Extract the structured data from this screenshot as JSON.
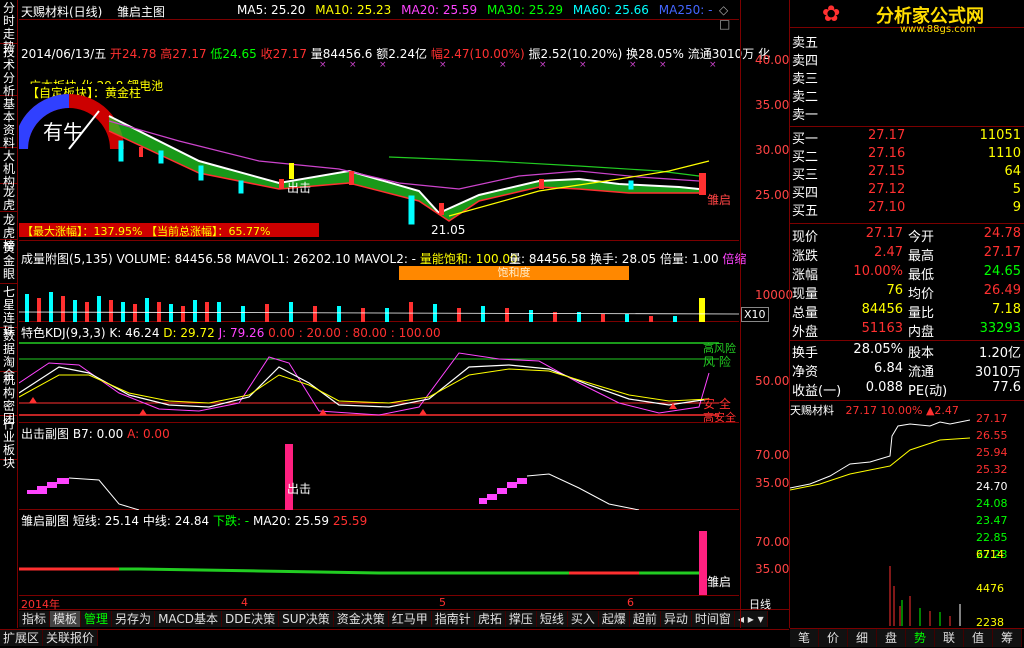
{
  "left_tabs": [
    "分时走势",
    "技术分析",
    "基本资料",
    "大机构",
    "龙虎",
    "龙虎榜",
    "黄金眼",
    "七星连珠",
    "数据淘金",
    "机构密团",
    "行业板块"
  ],
  "title": {
    "stock": "天赐材料(日线)",
    "formula": "雏启主图",
    "ma5": "MA5: 25.20",
    "ma10": "MA10: 25.23",
    "ma20": "MA20: 25.59",
    "ma30": "MA30: 25.29",
    "ma60": "MA60: 25.66",
    "ma250": "MA250: -"
  },
  "info_line": {
    "date": "2014/06/13/五",
    "open": "开24.78",
    "high": "高27.17",
    "low": "低24.65",
    "close": "收27.17",
    "vol": "量84456.6",
    "amt": "额2.24亿",
    "pct": "幅2.47(10.00%)",
    "amp": "振2.52(10.20%)",
    "turnover": "换28.05%",
    "float": "流通3010万",
    "extra": "化"
  },
  "main_panel": {
    "board_label": "【自定板块】：黄金柱",
    "overlay_text": "广本板块 化 29.8 锂电池",
    "gauge_label": "有牛",
    "signal_chuji": "出击",
    "signal_chuqi": "雏启",
    "low_label": "21.05",
    "max_gain": "【最大涨幅】：137.95%",
    "cur_gain": "【当前总涨幅】：65.77%",
    "yticks": [
      "40.00",
      "35.00",
      "30.00",
      "25.00"
    ]
  },
  "volume_panel": {
    "label": "成量附图(5,135)",
    "vol": "VOLUME: 84456.58",
    "mavol1": "MAVOL1: 26202.10",
    "mavol2": "MAVOL2: -",
    "sat": "量能饱和: 100.00",
    "right": "量: 84456.58",
    "turn": "换手: 28.05",
    "mult": "倍量: 1.00",
    "shrink": "倍缩",
    "badge": "饱和度",
    "ytick": "10000",
    "x10": "X10"
  },
  "kdj_panel": {
    "label": "特色KDJ(9,3,3)",
    "k": "K: 46.24",
    "d": "D: 29.72",
    "j": "J: 79.26",
    "levels": "0.00 : 20.00 : 80.00 : 100.00",
    "high_risk": "高风险",
    "risk": "风 险",
    "safe": "安 全",
    "high_safe": "高安全",
    "ytick": "50.00"
  },
  "chuji_panel": {
    "label": "出击副图",
    "b7": "B7: 0.00",
    "a": "A: 0.00",
    "signal": "出击",
    "yticks": [
      "70.00",
      "35.00"
    ]
  },
  "chuqi_panel": {
    "label": "雏启副图",
    "short": "短线: 25.14",
    "mid": "中线: 24.84",
    "down": "下跌: -",
    "ma20": "MA20: 25.59",
    "val": "25.59",
    "signal": "雏启",
    "yticks": [
      "70.00",
      "35.00"
    ]
  },
  "time_axis": {
    "year": "2014年",
    "m4": "4",
    "m5": "5",
    "m6": "6",
    "period": "日线"
  },
  "bottom_tabs": [
    "指标",
    "模板",
    "管理",
    "另存为",
    "MACD基本",
    "DDE决策",
    "SUP决策",
    "资金决策",
    "红马甲",
    "指南针",
    "虎拓",
    "撑压",
    "短线",
    "买入",
    "起爆",
    "超前",
    "异动",
    "时间窗"
  ],
  "bottom_tabs2": [
    "扩展区",
    "关联报价"
  ],
  "right_panel": {
    "logo": "分析家公式网",
    "logo_url": "www.88gs.com",
    "sell": [
      {
        "l": "卖五",
        "p": "",
        "v": ""
      },
      {
        "l": "卖四",
        "p": "",
        "v": ""
      },
      {
        "l": "卖三",
        "p": "",
        "v": ""
      },
      {
        "l": "卖二",
        "p": "",
        "v": ""
      },
      {
        "l": "卖一",
        "p": "",
        "v": ""
      }
    ],
    "buy": [
      {
        "l": "买一",
        "p": "27.17",
        "v": "11051"
      },
      {
        "l": "买二",
        "p": "27.16",
        "v": "1110"
      },
      {
        "l": "买三",
        "p": "27.15",
        "v": "64"
      },
      {
        "l": "买四",
        "p": "27.12",
        "v": "5"
      },
      {
        "l": "买五",
        "p": "27.10",
        "v": "9"
      }
    ],
    "quote": [
      {
        "l1": "现价",
        "v1": "27.17",
        "l2": "今开",
        "v2": "24.78"
      },
      {
        "l1": "涨跌",
        "v1": "2.47",
        "l2": "最高",
        "v2": "27.17"
      },
      {
        "l1": "涨幅",
        "v1": "10.00%",
        "l2": "最低",
        "v2": "24.65"
      },
      {
        "l1": "现量",
        "v1": "76",
        "l2": "均价",
        "v2": "26.49"
      },
      {
        "l1": "总量",
        "v1": "84456",
        "l2": "量比",
        "v2": "7.18"
      },
      {
        "l1": "外盘",
        "v1": "51163",
        "l2": "内盘",
        "v2": "33293"
      }
    ],
    "stats": [
      {
        "l1": "换手",
        "v1": "28.05%",
        "l2": "股本",
        "v2": "1.20亿"
      },
      {
        "l1": "净资",
        "v1": "6.84",
        "l2": "流通",
        "v2": "3010万"
      },
      {
        "l1": "收益(一)",
        "v1": "0.088",
        "l2": "PE(动)",
        "v2": "77.6"
      }
    ],
    "mini": {
      "name": "天赐材料",
      "price": "27.17",
      "pct": "10.00%",
      "chg": "▲2.47",
      "ticks": [
        "27.17",
        "26.55",
        "25.94",
        "25.32",
        "24.70",
        "24.08",
        "23.47",
        "22.85",
        "22.23"
      ],
      "vticks": [
        "6714",
        "4476",
        "2238"
      ]
    },
    "tabs": [
      "笔",
      "价",
      "细",
      "盘",
      "势",
      "联",
      "值",
      "筹"
    ]
  }
}
